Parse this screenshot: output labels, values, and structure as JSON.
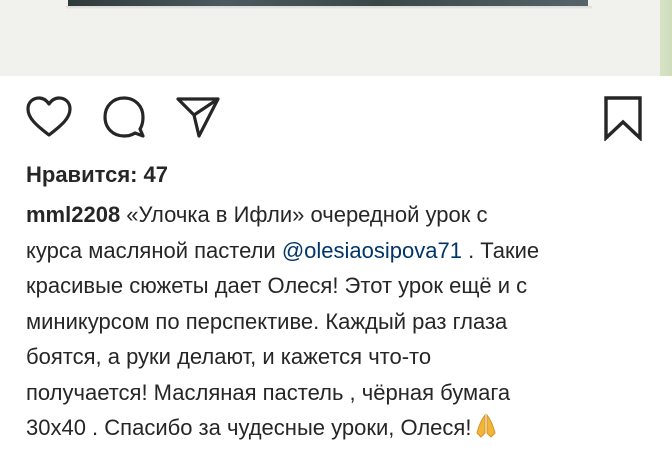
{
  "likes": {
    "label": "Нравится:",
    "count": "47"
  },
  "caption": {
    "username": "mml2208",
    "line1_text": " «Улочка в Ифли» очередной урок с",
    "line2_prefix": "курса масляной пастели ",
    "mention": "@olesiaosipova71",
    "line2_suffix": " . Такие",
    "line3": "красивые сюжеты дает Олеся! Этот урок ещё и с",
    "line4": "миникурсом по перспективе. Каждый раз глаза",
    "line5": "боятся, а руки делают, и кажется что-то",
    "line6": "получается! Масляная пастель , чёрная бумага",
    "line7": "30х40 . Спасибо за чудесные уроки, Олеся!",
    "emoji": "folded-hands-icon"
  },
  "icons": {
    "like": "heart-icon",
    "comment": "comment-icon",
    "share": "paper-plane-icon",
    "save": "bookmark-icon"
  },
  "colors": {
    "text": "#262626",
    "mention": "#003569",
    "emoji": "#f2b535"
  }
}
